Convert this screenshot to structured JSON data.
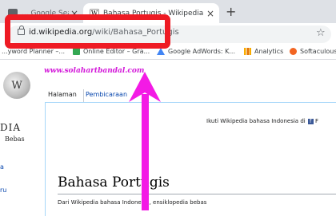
{
  "browser": {
    "tabs": [
      {
        "title": "... Google Search Console ...",
        "active": false
      },
      {
        "title": "Bahasa Portugis - Wikipedia bahasa ...",
        "active": true
      }
    ],
    "new_tab_label": "+",
    "tab_close_glyph": "×",
    "url_host": "id.wikipedia.org",
    "url_path": "/wiki/Bahasa_Portugis"
  },
  "bookmarks": [
    {
      "label": "...yword Planner –...",
      "icon": "google-ads-icon",
      "color": "#fbbc05"
    },
    {
      "label": "Online Editor – Gra...",
      "icon": "checkmark-icon",
      "color": "#34a853"
    },
    {
      "label": "Google AdWords: K...",
      "icon": "adwords-icon",
      "color": "#4285f4"
    },
    {
      "label": "Analytics",
      "icon": "analytics-icon",
      "color": "#f9ab00"
    },
    {
      "label": "Softaculous",
      "icon": "softaculous-icon",
      "color": "#f26522"
    }
  ],
  "watermark": "www.solahartbandal.com",
  "wiki": {
    "logo_word": "DIA",
    "logo_sub": "Bebas",
    "side_fragment_1": "a",
    "side_fragment_2": "ru",
    "tabs": [
      "Halaman",
      "Pembicaraan"
    ],
    "notice": "Ikuti Wikipedia bahasa Indonesia di",
    "notice_fb": "f",
    "notice_suffix": "F",
    "title": "Bahasa Portugis",
    "subtitle": "Dari Wikipedia bahasa Indonesia, ensiklopedia bebas"
  },
  "annotation": {
    "box_color": "#ee1b24",
    "arrow_color": "#f31ae5"
  }
}
